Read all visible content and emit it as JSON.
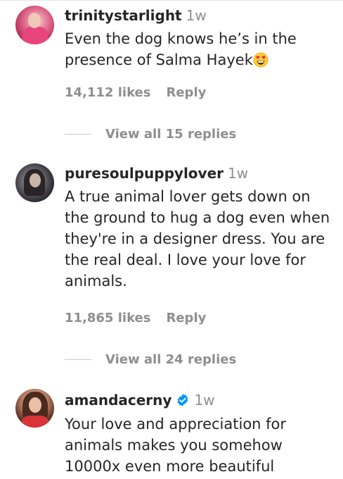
{
  "comments": [
    {
      "username": "trinitystarlight",
      "time": "1w",
      "text_main": "Even the dog knows he’s in the presence of Salma Hayek",
      "emoji": "heart-eyes-emoji",
      "likes": "14,112 likes",
      "reply_label": "Reply",
      "view_replies": "View all 15 replies"
    },
    {
      "username": "puresoulpuppylover",
      "time": "1w",
      "text": "A true animal lover gets down on the ground to hug a dog even when they're in a designer dress. You are the real deal. I love your love for animals.",
      "likes": "11,865 likes",
      "reply_label": "Reply",
      "view_replies": "View all 24 replies"
    },
    {
      "username": "amandacerny",
      "verified": true,
      "time": "1w",
      "text": "Your love and appreciation for animals makes you somehow 10000x even more beautiful"
    }
  ],
  "colors": {
    "text": "#262626",
    "muted": "#8e8e8e",
    "verified_blue": "#0095f6"
  }
}
